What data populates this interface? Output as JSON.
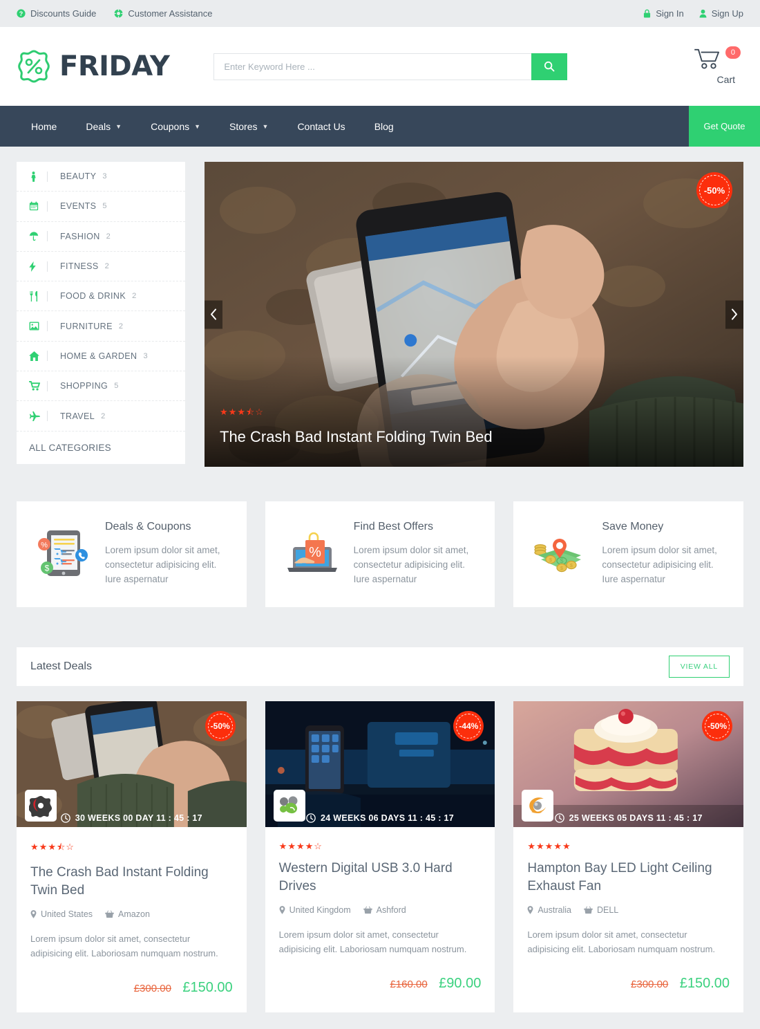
{
  "topbar": {
    "left_links": [
      {
        "label": "Discounts Guide",
        "icon": "question-circle-icon"
      },
      {
        "label": "Customer Assistance",
        "icon": "life-ring-icon"
      }
    ],
    "right_links": [
      {
        "label": "Sign In",
        "icon": "lock-icon"
      },
      {
        "label": "Sign Up",
        "icon": "user-icon"
      }
    ]
  },
  "header": {
    "brand": "FRIDAY",
    "search_placeholder": "Enter Keyword Here ...",
    "search_value": "",
    "cart_count": "0",
    "cart_label": "Cart"
  },
  "nav": {
    "items": [
      {
        "label": "Home",
        "has_caret": false
      },
      {
        "label": "Deals",
        "has_caret": true
      },
      {
        "label": "Coupons",
        "has_caret": true
      },
      {
        "label": "Stores",
        "has_caret": true
      },
      {
        "label": "Contact Us",
        "has_caret": false
      },
      {
        "label": "Blog",
        "has_caret": false
      }
    ],
    "cta": "Get Quote"
  },
  "categories": {
    "items": [
      {
        "name": "BEAUTY",
        "count": "3",
        "icon": "person-icon"
      },
      {
        "name": "EVENTS",
        "count": "5",
        "icon": "calendar-icon"
      },
      {
        "name": "FASHION",
        "count": "2",
        "icon": "umbrella-icon"
      },
      {
        "name": "FITNESS",
        "count": "2",
        "icon": "bolt-icon"
      },
      {
        "name": "FOOD & DRINK",
        "count": "2",
        "icon": "cutlery-icon"
      },
      {
        "name": "FURNITURE",
        "count": "2",
        "icon": "picture-icon"
      },
      {
        "name": "HOME & GARDEN",
        "count": "3",
        "icon": "home-icon"
      },
      {
        "name": "SHOPPING",
        "count": "5",
        "icon": "cart-icon"
      },
      {
        "name": "TRAVEL",
        "count": "2",
        "icon": "plane-icon"
      }
    ],
    "all_label": "ALL CATEGORIES"
  },
  "hero": {
    "title": "The Crash Bad Instant Folding Twin Bed",
    "discount": "-50%",
    "rating": 3.5,
    "prev_icon": "chevron-left-icon",
    "next_icon": "chevron-right-icon"
  },
  "features": [
    {
      "title": "Deals & Coupons",
      "text": "Lorem ipsum dolor sit amet, consectetur adipisicing elit. Iure aspernatur",
      "icon": "tablet-deals-icon"
    },
    {
      "title": "Find Best Offers",
      "text": "Lorem ipsum dolor sit amet, consectetur adipisicing elit. Iure aspernatur",
      "icon": "laptop-shopping-bag-icon"
    },
    {
      "title": "Save Money",
      "text": "Lorem ipsum dolor sit amet, consectetur adipisicing elit. Iure aspernatur",
      "icon": "money-coins-pin-icon"
    }
  ],
  "latest_deals": {
    "title": "Latest Deals",
    "view_all": "VIEW ALL",
    "cards": [
      {
        "discount": "-50%",
        "countdown": "30 WEEKS 00 DAY 11 : 45 : 17",
        "rating": 3.5,
        "title": "The Crash Bad Instant Folding Twin Bed",
        "location": "United States",
        "store": "Amazon",
        "description": "Lorem ipsum dolor sit amet, consectetur adipisicing elit. Laboriosam numquam nostrum.",
        "price_old": "£300.00",
        "price_new": "£150.00",
        "store_logo": "red-black-abstract-logo"
      },
      {
        "discount": "-44%",
        "countdown": "24 WEEKS 06 DAYS 11 : 45 : 17",
        "rating": 4,
        "title": "Western Digital USB 3.0 Hard Drives",
        "location": "United Kingdom",
        "store": "Ashford",
        "description": "Lorem ipsum dolor sit amet, consectetur adipisicing elit. Laboriosam numquam nostrum.",
        "price_old": "£160.00",
        "price_new": "£90.00",
        "store_logo": "green-grey-blob-logo"
      },
      {
        "discount": "-50%",
        "countdown": "25 WEEKS 05 DAYS 11 : 45 : 17",
        "rating": 5,
        "title": "Hampton Bay LED Light Ceiling Exhaust Fan",
        "location": "Australia",
        "store": "DELL",
        "description": "Lorem ipsum dolor sit amet, consectetur adipisicing elit. Laboriosam numquam nostrum.",
        "price_old": "£300.00",
        "price_new": "£150.00",
        "store_logo": "orange-swirl-sphere-logo"
      }
    ]
  },
  "colors": {
    "green": "#2fd072",
    "nav_dark": "#37475a",
    "discount_red": "#fc2e0c",
    "star_red": "#f8391a",
    "price_old": "#e8643c",
    "price_new": "#3ad17e"
  }
}
